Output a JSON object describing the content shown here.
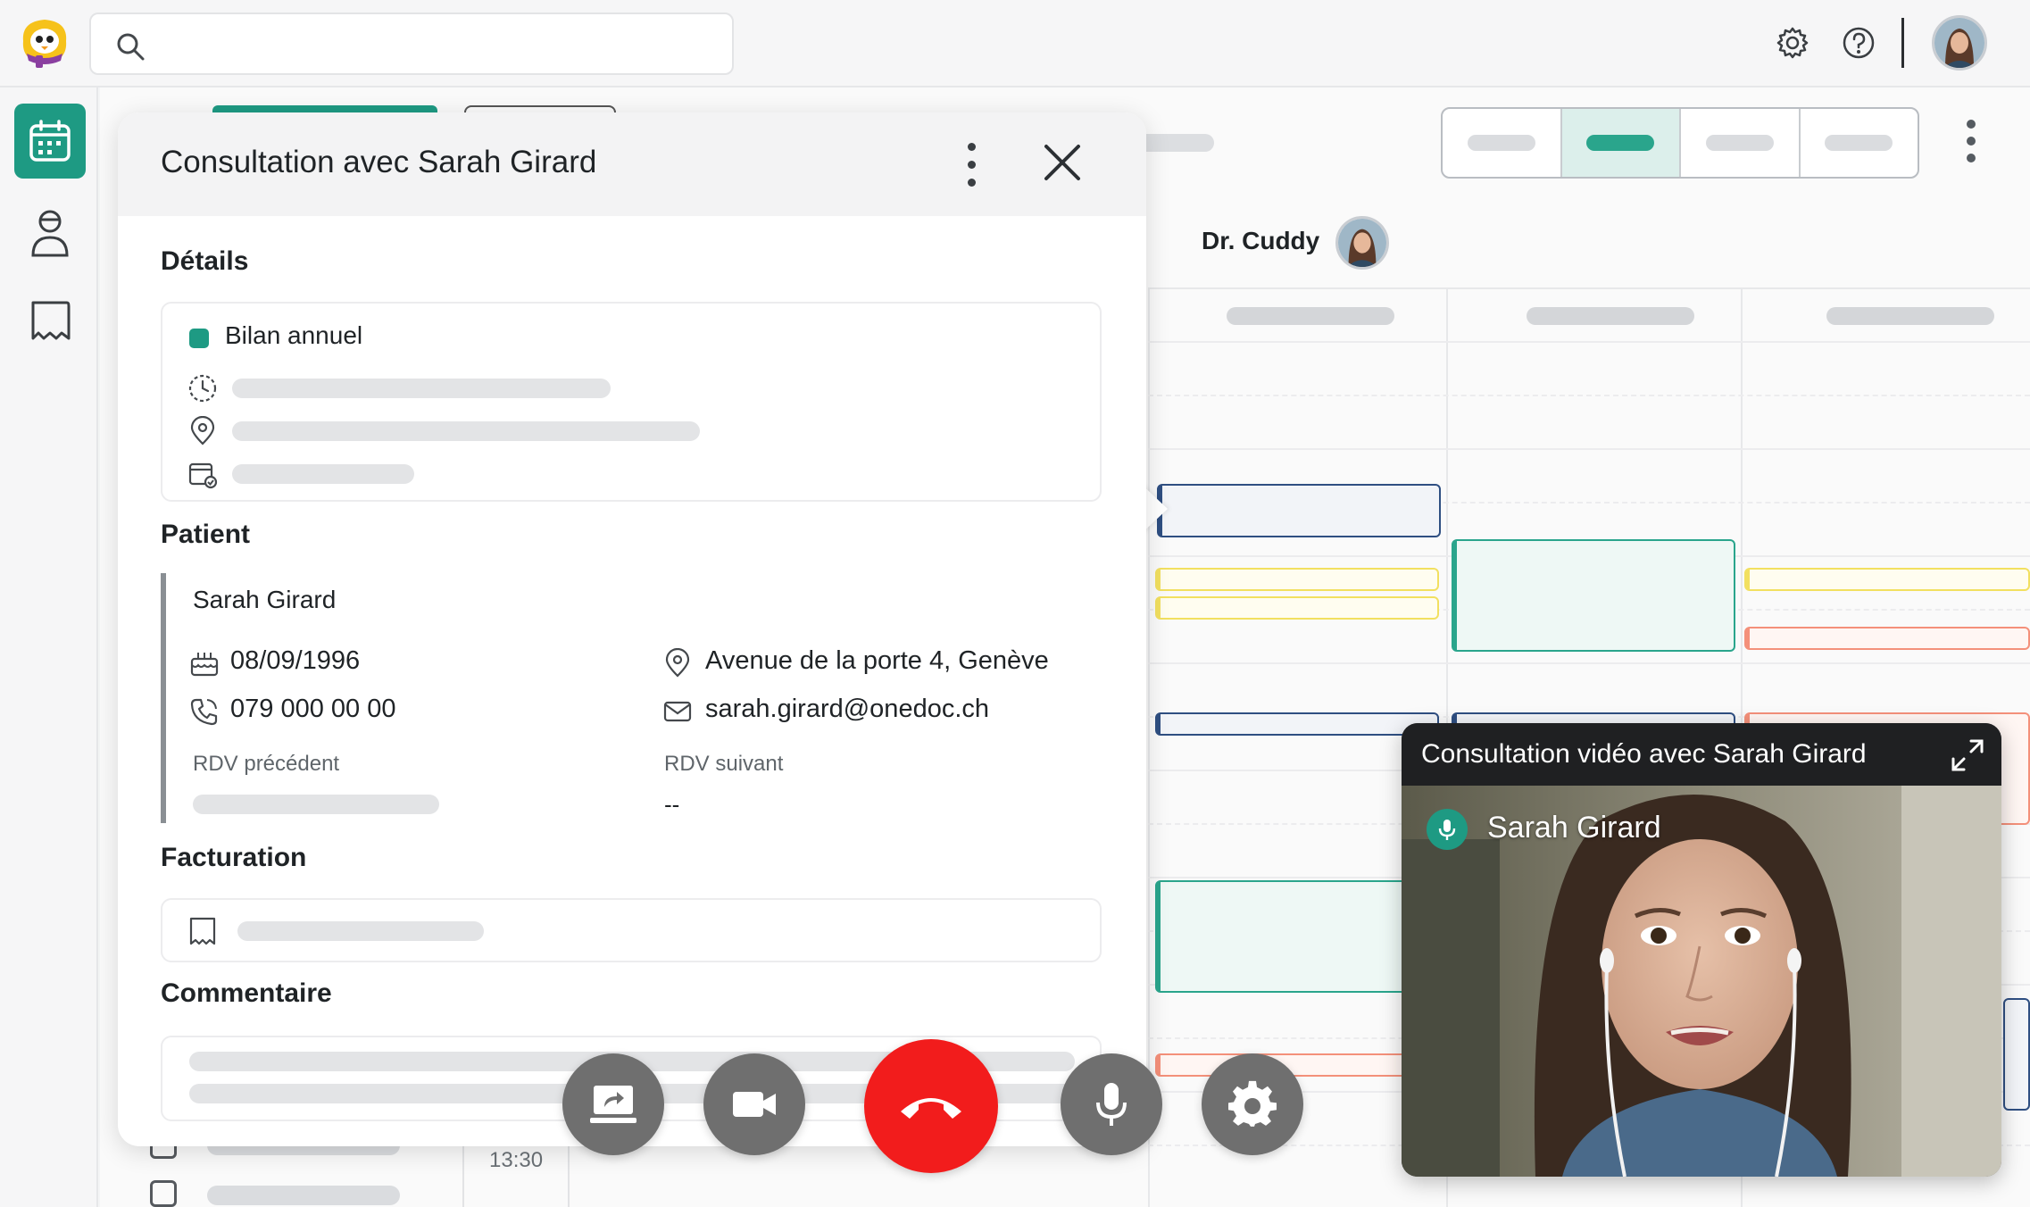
{
  "app": {
    "brand_color": "#1e9a83"
  },
  "topbar": {
    "search_placeholder": "",
    "icons": [
      "search-icon",
      "gear-icon",
      "help-icon",
      "avatar"
    ]
  },
  "sidenav": {
    "items": [
      {
        "icon": "calendar-icon",
        "active": true
      },
      {
        "icon": "patients-icon",
        "active": false
      },
      {
        "icon": "billing-icon",
        "active": false
      }
    ]
  },
  "calendar": {
    "doctor_name": "Dr. Cuddy",
    "time_label": "13:30",
    "view_selected_index": 1
  },
  "panel": {
    "title": "Consultation avec Sarah Girard",
    "details_heading": "Détails",
    "appointment_type": "Bilan annuel",
    "patient_heading": "Patient",
    "patient": {
      "name": "Sarah Girard",
      "birthdate": "08/09/1996",
      "phone": "079 000 00 00",
      "address": "Avenue de la porte 4, Genève",
      "email": "sarah.girard@onedoc.ch",
      "prev_label": "RDV précédent",
      "next_label": "RDV suivant",
      "next_value": "--"
    },
    "billing_heading": "Facturation",
    "comment_heading": "Commentaire"
  },
  "video": {
    "title": "Consultation vidéo avec Sarah Girard",
    "participant": "Sarah Girard"
  },
  "call_controls": {
    "end_call_color": "#f21c1c",
    "buttons": [
      "share-screen",
      "camera",
      "end-call",
      "microphone",
      "settings"
    ]
  }
}
